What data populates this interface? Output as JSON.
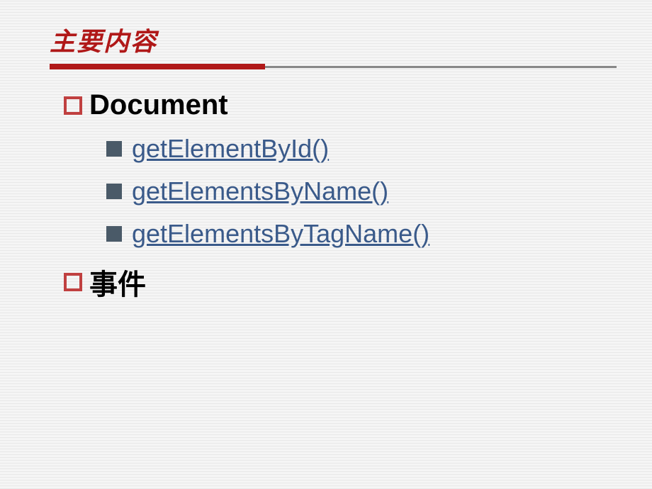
{
  "slide": {
    "title": "主要内容",
    "items": [
      {
        "type": "level1",
        "text": "Document"
      },
      {
        "type": "level2",
        "text": "getElementById()"
      },
      {
        "type": "level2",
        "text": "getElementsByName()"
      },
      {
        "type": "level2",
        "text": "getElementsByTagName()"
      },
      {
        "type": "level1-cn",
        "text": "事件"
      }
    ]
  }
}
